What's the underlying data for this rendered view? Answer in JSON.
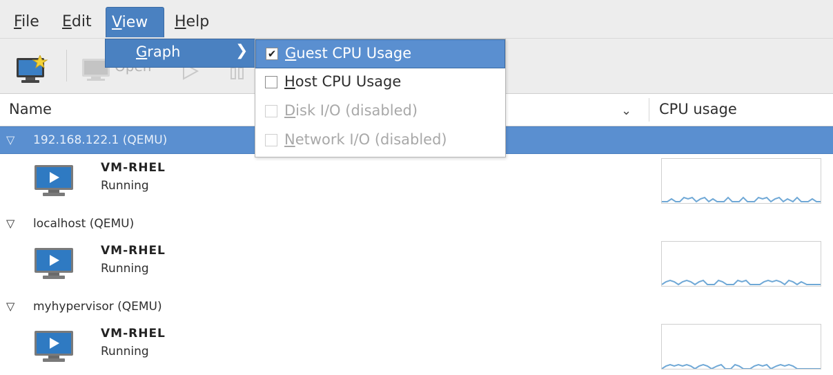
{
  "menubar": {
    "items": [
      {
        "accel": "F",
        "rest": "ile"
      },
      {
        "accel": "E",
        "rest": "dit"
      },
      {
        "accel": "V",
        "rest": "iew"
      },
      {
        "accel": "H",
        "rest": "elp"
      }
    ]
  },
  "toolbar": {
    "open_label": "Open"
  },
  "columns": {
    "name": "Name",
    "cpu": "CPU usage",
    "sort_glyph": "⌄"
  },
  "connections": [
    {
      "label": "192.168.122.1 (QEMU)",
      "vm": {
        "name": "VM-RHEL",
        "status": "Running"
      }
    },
    {
      "label": "localhost (QEMU)",
      "vm": {
        "name": "VM-RHEL",
        "status": "Running"
      }
    },
    {
      "label": "myhypervisor (QEMU)",
      "vm": {
        "name": "VM-RHEL",
        "status": "Running"
      }
    }
  ],
  "view_menu": {
    "submenu": {
      "accel": "G",
      "rest": "raph",
      "arrow": "❯"
    },
    "items": [
      {
        "accel": "G",
        "rest": "uest CPU Usage",
        "checked": "✔"
      },
      {
        "accel": "H",
        "rest": "ost CPU Usage",
        "checked": ""
      },
      {
        "accel": "D",
        "rest": "isk I/O (disabled)",
        "checked": ""
      },
      {
        "accel": "N",
        "rest": "etwork I/O (disabled)",
        "checked": ""
      }
    ]
  },
  "colors": {
    "selection": "#5a8fd0",
    "menu_active": "#4a81c1",
    "graph_line": "#6fa8d6"
  }
}
